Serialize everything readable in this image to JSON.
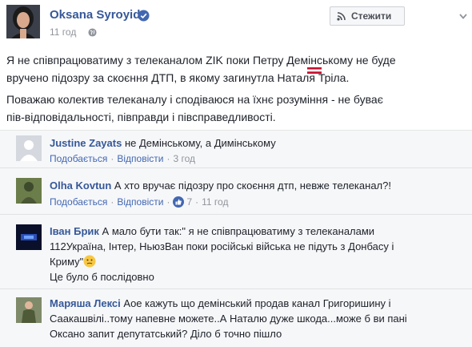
{
  "post": {
    "author": "Oksana Syroyid",
    "time": "11 год",
    "follow_label": "Стежити",
    "paragraph1_line1": "Я не співпрацюватиму з телеканалом ZIK поки Петру Демінському не буде",
    "paragraph1_line2": "вручено підозру за скоєння ДТП, в якому загинутла Наталя Тріла.",
    "paragraph2_line1": "Поважаю колектив телеканалу і сподіваюся на їхнє розуміння - не буває",
    "paragraph2_line2": "пів-відповідальності, півправди і півсправедливості."
  },
  "comments": [
    {
      "name": "Justine Zayats",
      "text": "не Демінському, а Димінському",
      "like": "Подобається",
      "reply": "Відповісти",
      "time": "3 год"
    },
    {
      "name": "Olha Kovtun",
      "text": "А хто вручає підозру про скоєння дтп, невже телеканал?!",
      "like": "Подобається",
      "reply": "Відповісти",
      "likes": "7",
      "time": "11 год"
    },
    {
      "name": "Іван Брик",
      "line1": "А мало бути так:\" я не співпрацюватиму з телеканалами",
      "line2": "112Україна, Інтер, НьюзВан поки російські війська не підуть з Донбасу і",
      "line3": "Криму\"",
      "line4": "Це було б послідовно"
    },
    {
      "name": "Маряша Лексі",
      "line1": "Аое кажуть що демінський продав канал Григоришину і",
      "line2": "Саакашвілі..тому напевне можете..А Наталю дуже шкода...може б ви пані",
      "line3": "Оксано запит депутатський? Діло б точно пішло"
    }
  ],
  "colors": {
    "link": "#365899",
    "action": "#4267b2",
    "meta": "#90949c",
    "comments_bg": "#f6f7f9"
  },
  "icons": [
    "verified-icon",
    "globe-icon",
    "rss-icon",
    "chevron-down-icon",
    "flag-icon",
    "like-icon",
    "emoji-icon"
  ]
}
